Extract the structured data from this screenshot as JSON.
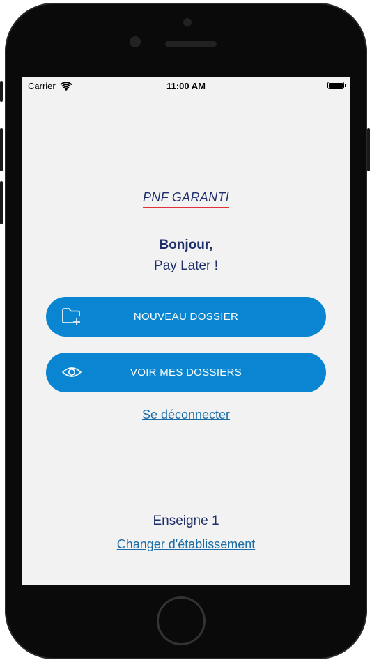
{
  "status_bar": {
    "carrier": "Carrier",
    "time": "11:00 AM",
    "battery_level": 1.0
  },
  "brand": {
    "name": "PNF GARANTI",
    "underline_color": "#e0303a"
  },
  "greeting": {
    "hello": "Bonjour,",
    "user": "Pay Later !"
  },
  "actions": {
    "new_file_label": "NOUVEAU DOSSIER",
    "new_file_icon": "folder-plus-icon",
    "view_files_label": "VOIR MES DOSSIERS",
    "view_files_icon": "eye-icon",
    "logout_label": "Se déconnecter"
  },
  "store": {
    "name": "Enseigne 1",
    "change_label": "Changer d'établissement"
  },
  "colors": {
    "primary_button": "#0a85d1",
    "text_navy": "#1f2f6b",
    "link": "#1a6ba6",
    "screen_bg": "#f2f2f2"
  }
}
